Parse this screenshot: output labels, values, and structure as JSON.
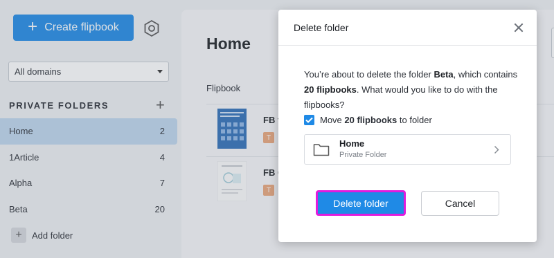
{
  "sidebar": {
    "create_label": "Create flipbook",
    "domain_select_value": "All domains",
    "private_folders_title": "PRIVATE FOLDERS",
    "folders": [
      {
        "name": "Home",
        "count": "2"
      },
      {
        "name": "1Article",
        "count": "4"
      },
      {
        "name": "Alpha",
        "count": "7"
      },
      {
        "name": "Beta",
        "count": "20"
      }
    ],
    "add_folder_label": "Add folder"
  },
  "main": {
    "title": "Home",
    "column_header": "Flipbook",
    "rows": [
      {
        "name": "FB f",
        "tag": "T"
      },
      {
        "name": "FB C",
        "tag": "T"
      }
    ]
  },
  "modal": {
    "title": "Delete folder",
    "body_part1": "You’re about to delete the folder ",
    "folder_name": "Beta",
    "body_part2": ", which contains ",
    "flipbook_count": "20 flipbooks",
    "body_part3": ". What would you like to do with the flipbooks?",
    "checkbox_pre": "Move ",
    "checkbox_bold": "20 flipbooks",
    "checkbox_post": " to folder",
    "target_folder": "Home",
    "target_folder_sub": "Private Folder",
    "delete_button": "Delete folder",
    "cancel_button": "Cancel"
  },
  "colors": {
    "accent": "#1f8ae6",
    "active_folder_bg": "#bed7ee",
    "highlight_border": "#e11bdd",
    "tag": "#e9a67a"
  },
  "icons": [
    "plus-icon",
    "settings-icon",
    "chevron-down-icon",
    "close-icon",
    "check-icon",
    "folder-icon",
    "chevron-right-icon"
  ]
}
